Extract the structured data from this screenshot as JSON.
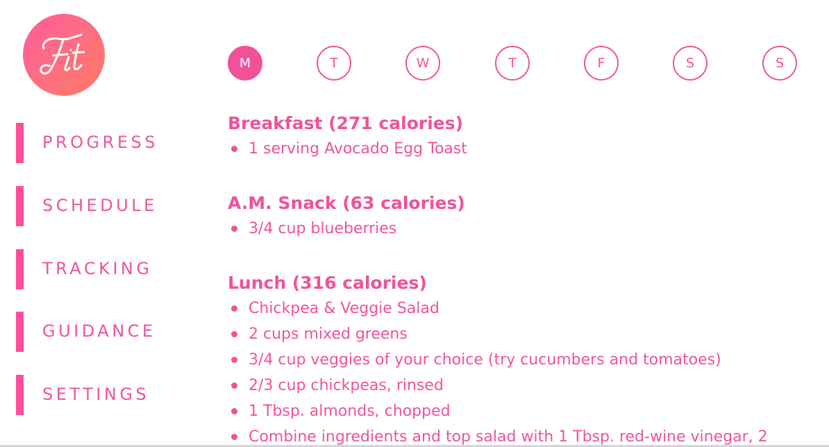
{
  "logo": {
    "text": "Fit",
    "colors": [
      "#ff5c9a",
      "#ff7a62"
    ]
  },
  "theme": {
    "accent": "#f0529a",
    "nav_bar": "#ff4f9a",
    "background": "#ffffff"
  },
  "days": [
    {
      "label": "M",
      "active": true
    },
    {
      "label": "T",
      "active": false
    },
    {
      "label": "W",
      "active": false
    },
    {
      "label": "T",
      "active": false
    },
    {
      "label": "F",
      "active": false
    },
    {
      "label": "S",
      "active": false
    },
    {
      "label": "S",
      "active": false
    }
  ],
  "sidebar": {
    "items": [
      {
        "label": "PROGRESS"
      },
      {
        "label": "SCHEDULE"
      },
      {
        "label": "TRACKING"
      },
      {
        "label": "GUIDANCE"
      },
      {
        "label": "SETTINGS"
      }
    ]
  },
  "meals": [
    {
      "title": "Breakfast (271 calories)",
      "items": [
        "1 serving Avocado Egg Toast"
      ]
    },
    {
      "title": "A.M. Snack (63 calories)",
      "items": [
        "3/4 cup blueberries"
      ]
    },
    {
      "title": "Lunch (316 calories)",
      "items": [
        "Chickpea & Veggie Salad",
        "2 cups mixed greens",
        "3/4 cup veggies of your choice (try cucumbers and tomatoes)",
        "2/3 cup chickpeas, rinsed",
        "1 Tbsp. almonds, chopped",
        "Combine ingredients and top salad with 1 Tbsp. red-wine vinegar, 2"
      ]
    }
  ]
}
